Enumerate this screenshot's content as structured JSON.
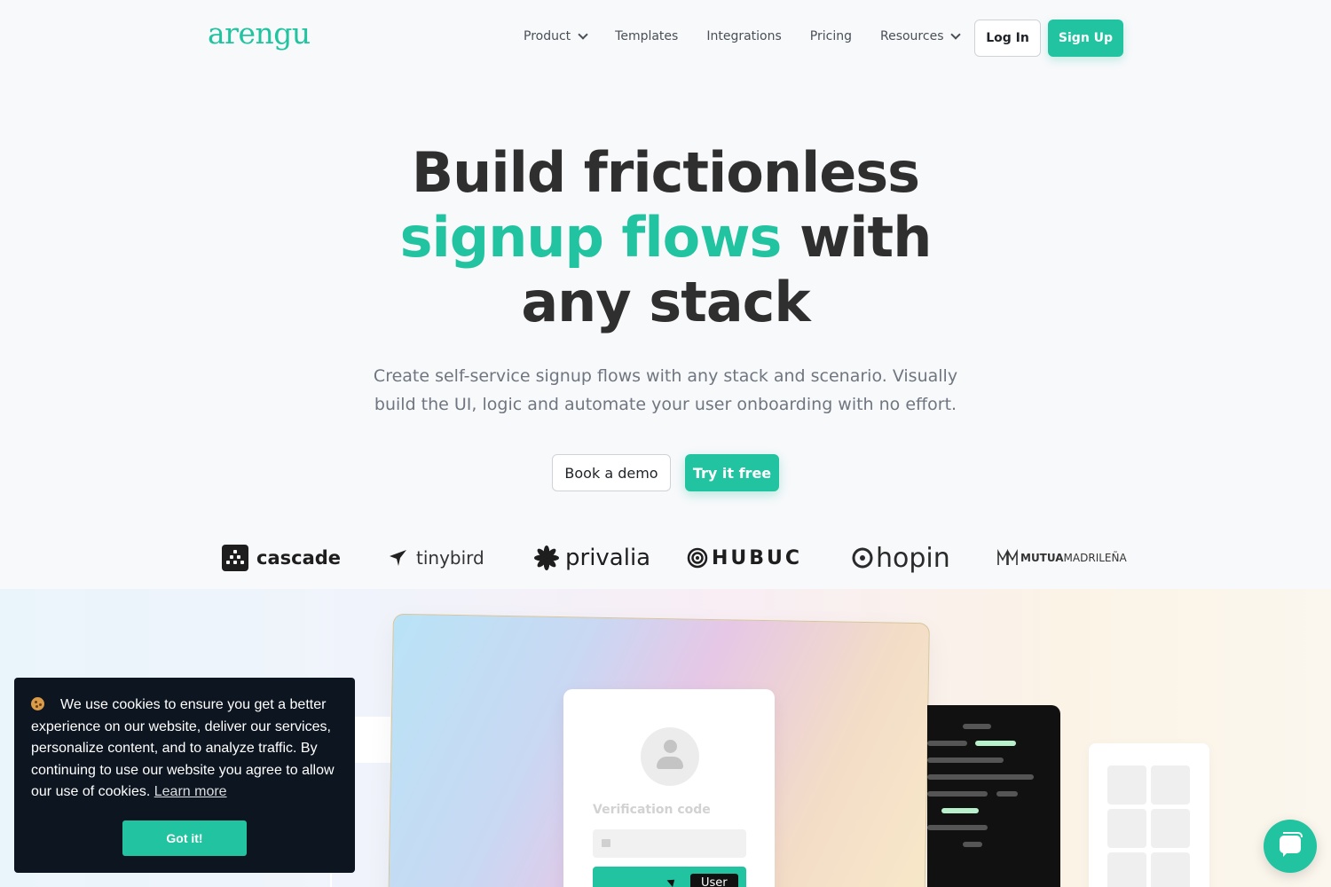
{
  "nav": {
    "logo": "arengu",
    "links": [
      {
        "label": "Product",
        "has_dropdown": true
      },
      {
        "label": "Templates",
        "has_dropdown": false
      },
      {
        "label": "Integrations",
        "has_dropdown": false
      },
      {
        "label": "Pricing",
        "has_dropdown": false
      },
      {
        "label": "Resources",
        "has_dropdown": true
      }
    ],
    "login_label": "Log In",
    "signup_label": "Sign Up"
  },
  "hero": {
    "title_line1": "Build frictionless",
    "title_accent": "signup flows",
    "title_line2_rest": " with",
    "title_line3": "any stack",
    "subtitle": "Create self-service signup flows with any stack and scenario. Visually build the UI, logic and automate your user onboarding with no effort.",
    "demo_label": "Book a demo",
    "try_label": "Try it free"
  },
  "logos": [
    {
      "name": "cascade",
      "icon": "cascade-icon"
    },
    {
      "name": "tinybird",
      "icon": "bird-icon"
    },
    {
      "name": "privalia",
      "icon": "flower-icon"
    },
    {
      "name": "HUBUC",
      "icon": "target-icon"
    },
    {
      "name": "hopin",
      "icon": "swirl-icon"
    },
    {
      "name_bold": "MUTUA",
      "name_light": "MADRILEÑA",
      "icon": "mm-icon"
    }
  ],
  "showcase": {
    "verification_label": "Verification code",
    "user_chip": "User"
  },
  "cookie": {
    "text": "We use cookies to ensure you get a better experience on our website, deliver our services, personalize content, and to analyze traffic. By continuing to use our website you agree to allow our use of cookies.",
    "learn_more": "Learn more",
    "button": "Got it!"
  },
  "colors": {
    "accent": "#22c3a0",
    "text": "#2f2f2f",
    "cookie_bg": "#0d1520"
  }
}
